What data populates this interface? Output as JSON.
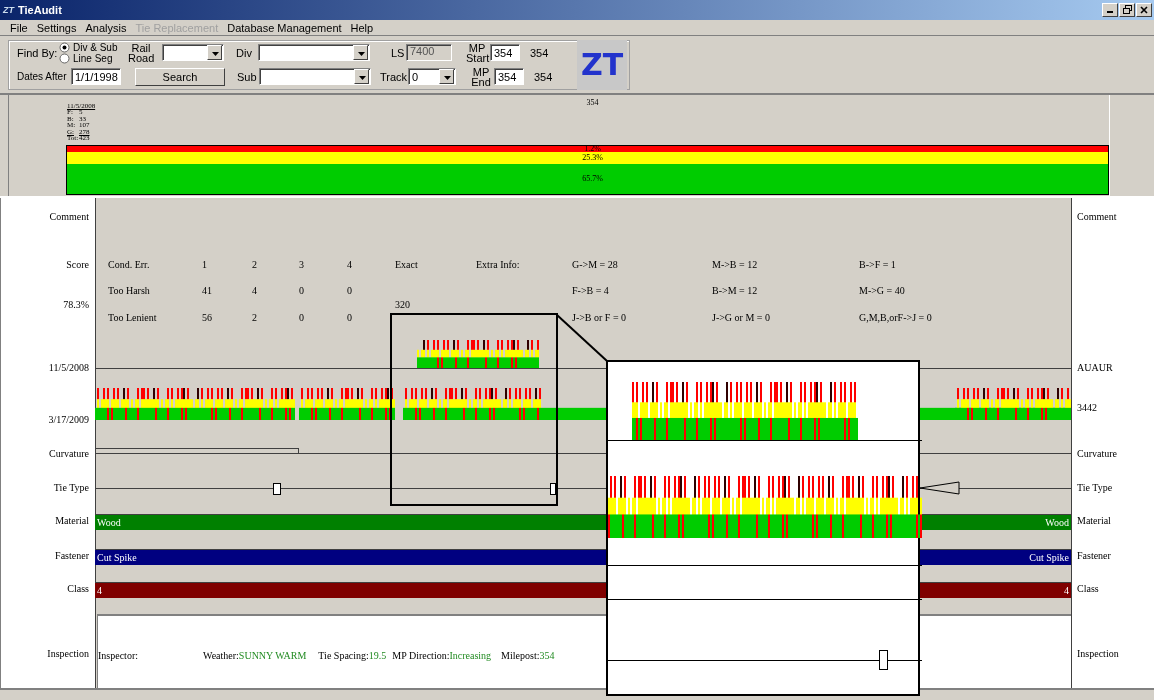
{
  "window": {
    "icon": "ZT",
    "title": "TieAudit"
  },
  "menu": [
    {
      "label": "File",
      "disabled": false
    },
    {
      "label": "Settings",
      "disabled": false
    },
    {
      "label": "Analysis",
      "disabled": false
    },
    {
      "label": "Tie Replacement",
      "disabled": true
    },
    {
      "label": "Database Management",
      "disabled": false
    },
    {
      "label": "Help",
      "disabled": false
    }
  ],
  "filter": {
    "find_by": {
      "label": "Find By:",
      "options": [
        {
          "label": "Div & Sub",
          "selected": true
        },
        {
          "label": "Line Seg",
          "selected": false
        }
      ]
    },
    "dates_after": {
      "label": "Dates After",
      "value": "1/1/1998"
    },
    "railroad": {
      "label": "Rail Road"
    },
    "search_button": "Search",
    "div": {
      "label": "Div"
    },
    "sub": {
      "label": "Sub"
    },
    "ls": {
      "label": "LS",
      "value": "7400",
      "disabled": true
    },
    "track": {
      "label": "Track",
      "value": "0"
    },
    "mp_start": {
      "label": "MP Start",
      "value": "354",
      "reading": "354"
    },
    "mp_end": {
      "label": "MP End",
      "value": "354",
      "reading": "354"
    }
  },
  "logo": "ZT",
  "summary": {
    "milepost": "354",
    "date": "11/5/2008",
    "counts": [
      {
        "key": "F:",
        "value": "5"
      },
      {
        "key": "B:",
        "value": "33"
      },
      {
        "key": "M:",
        "value": "107"
      },
      {
        "key": "G:",
        "value": "278"
      }
    ],
    "total": {
      "key": "Tot:",
      "value": "423"
    },
    "segments": [
      {
        "label": "1.2%",
        "color": "#ff0000"
      },
      {
        "label": "25.3%",
        "color": "#ffff00"
      },
      {
        "label": "65.7%",
        "color": "#00cc00"
      }
    ]
  },
  "comment": {
    "label": "Comment",
    "right_label": "Comment"
  },
  "score": {
    "label": "Score",
    "value": "78.3%",
    "header": {
      "label": "Cond. Err.",
      "counts": [
        "1",
        "2",
        "3",
        "4"
      ],
      "exact": "Exact",
      "extra_label": "Extra Info:",
      "extra": [
        "G->M = 28",
        "M->B = 12",
        "B->F = 1"
      ]
    },
    "rows": [
      {
        "label": "Too Harsh",
        "counts": [
          "41",
          "4",
          "0",
          "0"
        ],
        "extra": [
          "F->B = 4",
          "B->M = 12",
          "M->G = 40"
        ]
      },
      {
        "label": "Too Lenient",
        "counts": [
          "56",
          "2",
          "0",
          "0"
        ],
        "extra": [
          "J->B or F = 0",
          "J->G or M = 0",
          "G,M,B,orF->J = 0"
        ]
      }
    ],
    "exact_value": "320"
  },
  "inspections": [
    {
      "date": "11/5/2008",
      "right_label": "AUAUR"
    },
    {
      "date": "3/17/2009",
      "right_label": "3442"
    }
  ],
  "curvature": {
    "label": "Curvature",
    "right_label": "Curvature"
  },
  "tie_type": {
    "label": "Tie Type",
    "right_label": "Tie Type"
  },
  "attributes": [
    {
      "label": "Material",
      "value": "Wood",
      "value_end": "Wood",
      "right_label": "Material",
      "color": "#008000"
    },
    {
      "label": "Fastener",
      "value": "Cut Spike",
      "value_end": "Cut Spike",
      "right_label": "Fastener",
      "color": "#000080"
    },
    {
      "label": "Class",
      "value": "4",
      "value_end": "4",
      "right_label": "Class",
      "color": "#800000"
    }
  ],
  "inspection": {
    "label": "Inspection",
    "right_label": "Inspection",
    "fields": [
      {
        "label": "Inspector:"
      },
      {
        "label": "Weather:",
        "value": "SUNNY WARM"
      },
      {
        "label": "Tie Spacing:",
        "value": "19.5"
      },
      {
        "label": "MP Direction:",
        "value": "Increasing"
      },
      {
        "label": "Milepost:",
        "value": "354"
      }
    ]
  }
}
